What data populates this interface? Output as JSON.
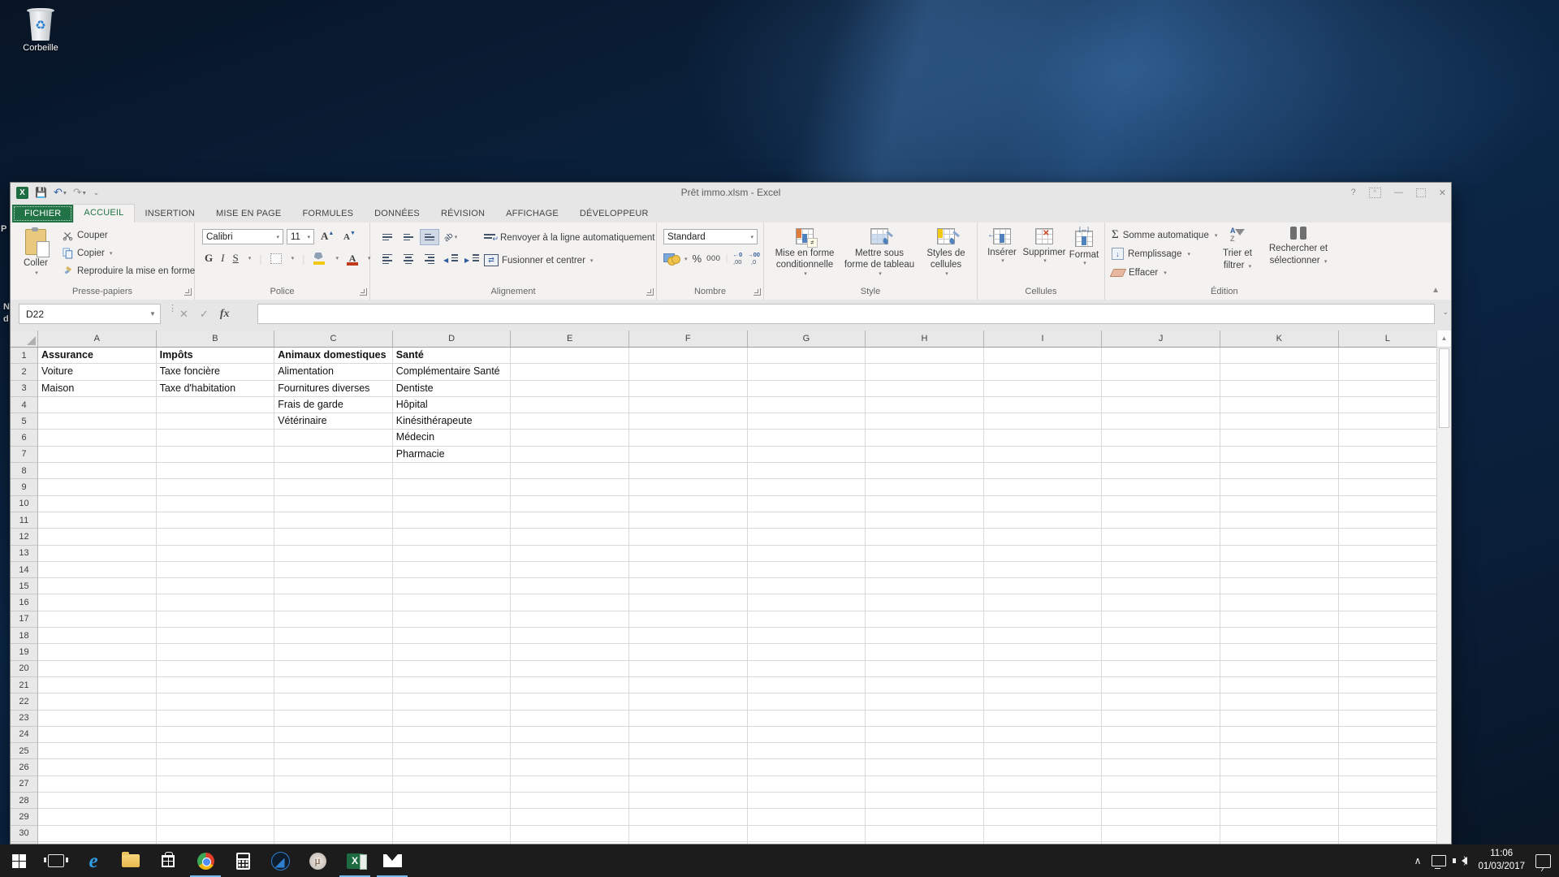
{
  "colors": {
    "excel_green": "#217346",
    "running_indicator": "#76b9ed",
    "taskbar_bg": "#1c1c1c",
    "desktop_blue": "#0b2747"
  },
  "desktop": {
    "recycle_bin_label": "Corbeille",
    "edge_fragments": [
      "P",
      "N",
      "d"
    ]
  },
  "window": {
    "title": "Prêt immo.xlsm - Excel",
    "controls": {
      "help": "?",
      "minimize": "—",
      "close": "✕"
    },
    "tabs": [
      {
        "label": "FICHIER"
      },
      {
        "label": "ACCUEIL"
      },
      {
        "label": "INSERTION"
      },
      {
        "label": "MISE EN PAGE"
      },
      {
        "label": "FORMULES"
      },
      {
        "label": "DONNÉES"
      },
      {
        "label": "RÉVISION"
      },
      {
        "label": "AFFICHAGE"
      },
      {
        "label": "DÉVELOPPEUR"
      }
    ],
    "ribbon": {
      "presse_papiers": {
        "group_label": "Presse-papiers",
        "coller": "Coller",
        "couper": "Couper",
        "copier": "Copier",
        "reproduire": "Reproduire la mise en forme"
      },
      "police": {
        "group_label": "Police",
        "font_name": "Calibri",
        "font_size": "11",
        "bold": "G",
        "italic": "I",
        "underline": "S",
        "grow": "A",
        "shrink": "A"
      },
      "alignement": {
        "group_label": "Alignement",
        "wrap": "Renvoyer à la ligne automatiquement",
        "merge": "Fusionner et centrer",
        "orientation": "ab"
      },
      "nombre": {
        "group_label": "Nombre",
        "format": "Standard",
        "percent": "%",
        "thousands": "000",
        "dec_more": "←0\n,00",
        "dec_less": "→00\n,0"
      },
      "style": {
        "group_label": "Style",
        "items": [
          "Mise en forme conditionnelle",
          "Mettre sous forme de tableau",
          "Styles de cellules"
        ]
      },
      "cellules": {
        "group_label": "Cellules",
        "items": [
          "Insérer",
          "Supprimer",
          "Format"
        ]
      },
      "edition": {
        "group_label": "Édition",
        "somme": "Somme automatique",
        "remplissage": "Remplissage",
        "effacer": "Effacer",
        "trier": "Trier et filtrer",
        "rechercher": "Rechercher et sélectionner"
      }
    },
    "formula_bar": {
      "name_box": "D22",
      "formula": ""
    },
    "sheet": {
      "columns": [
        "A",
        "B",
        "C",
        "D",
        "E",
        "F",
        "G",
        "H",
        "I",
        "J",
        "K",
        "L"
      ],
      "row_count": 31,
      "bold_row": 1,
      "cells": {
        "A1": "Assurance",
        "B1": "Impôts",
        "C1": "Animaux domestiques",
        "D1": "Santé",
        "A2": "Voiture",
        "B2": "Taxe foncière",
        "C2": "Alimentation",
        "D2": "Complémentaire Santé",
        "A3": "Maison",
        "B3": "Taxe d'habitation",
        "C3": "Fournitures diverses",
        "D3": "Dentiste",
        "C4": "Frais de garde",
        "D4": "Hôpital",
        "C5": "Vétérinaire",
        "D5": "Kinésithérapeute",
        "D6": "Médecin",
        "D7": "Pharmacie"
      }
    }
  },
  "taskbar": {
    "clock_time": "11:06",
    "clock_date": "01/03/2017",
    "items": [
      {
        "name": "start",
        "running": false
      },
      {
        "name": "task-view",
        "running": false
      },
      {
        "name": "edge",
        "running": false
      },
      {
        "name": "file-explorer",
        "running": false
      },
      {
        "name": "store",
        "running": false
      },
      {
        "name": "chrome",
        "running": true
      },
      {
        "name": "calculator",
        "running": false
      },
      {
        "name": "daemon-tools",
        "running": false
      },
      {
        "name": "utorrent",
        "running": false
      },
      {
        "name": "excel",
        "running": true
      },
      {
        "name": "mail",
        "running": true
      }
    ]
  }
}
